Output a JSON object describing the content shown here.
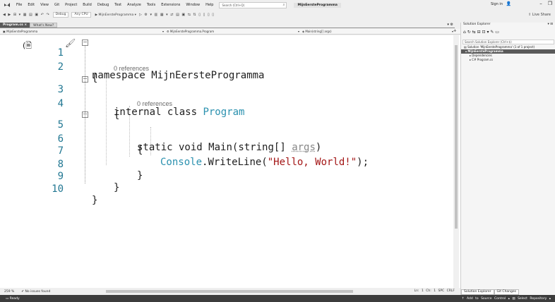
{
  "menubar": {
    "items": [
      "File",
      "Edit",
      "View",
      "Git",
      "Project",
      "Build",
      "Debug",
      "Test",
      "Analyze",
      "Tools",
      "Extensions",
      "Window",
      "Help"
    ],
    "search_placeholder": "Search (Ctrl+Q)",
    "solution_title": "MijnEersteProgramma",
    "signin": "Sign in"
  },
  "toolbar": {
    "config": "Debug",
    "platform": "Any CPU",
    "run_target": "▶ MijnEersteProgramma ▾",
    "live_share": "Live Share"
  },
  "tabs": [
    {
      "label": "Program.cs  ×"
    },
    {
      "label": "What's New?"
    }
  ],
  "navbar": {
    "project": "MijnEersteProgramma",
    "class": "MijnEersteProgramma.Program",
    "member": "Main(string[] args)"
  },
  "code": {
    "lines": [
      {
        "num": "1"
      },
      {
        "num": "2"
      },
      {
        "num": "3"
      },
      {
        "num": "4"
      },
      {
        "num": "5"
      },
      {
        "num": "6"
      },
      {
        "num": "7"
      },
      {
        "num": "8"
      },
      {
        "num": "9"
      },
      {
        "num": "10"
      }
    ],
    "refs_1": "0 references",
    "refs_2": "0 references",
    "ns_kw": "namespace",
    "ns_name": "MijnEersteProgramma",
    "class_mods": "internal class",
    "class_name": "Program",
    "method_mods": "static void",
    "method_name": "Main",
    "param_type": "string",
    "param_rest": "[]",
    "param_name": "args",
    "console": "Console",
    "writeline": ".WriteLine(",
    "string_lit": "\"Hello, World!\"",
    "close_call": ");"
  },
  "status": {
    "zoom": "259 %",
    "issues": "No issues found",
    "position": "Ln: 1   Ch: 1   SPC   CRLF",
    "ready": "Ready",
    "source_control": "↑ Add to Source Control ▴",
    "repo": "Select Repository ▴"
  },
  "solution_explorer": {
    "title": "Solution Explorer",
    "search_placeholder": "Search Solution Explorer (Ctrl+$)",
    "items": [
      {
        "label": "Solution 'MijnEersteProgramma' (1 of 1 project)"
      },
      {
        "label": "MijnEersteProgramma"
      },
      {
        "label": "Dependencies"
      },
      {
        "label": "C# Program.cs"
      }
    ],
    "bottom_tabs": [
      "Solution Explorer",
      "Git Changes"
    ]
  }
}
